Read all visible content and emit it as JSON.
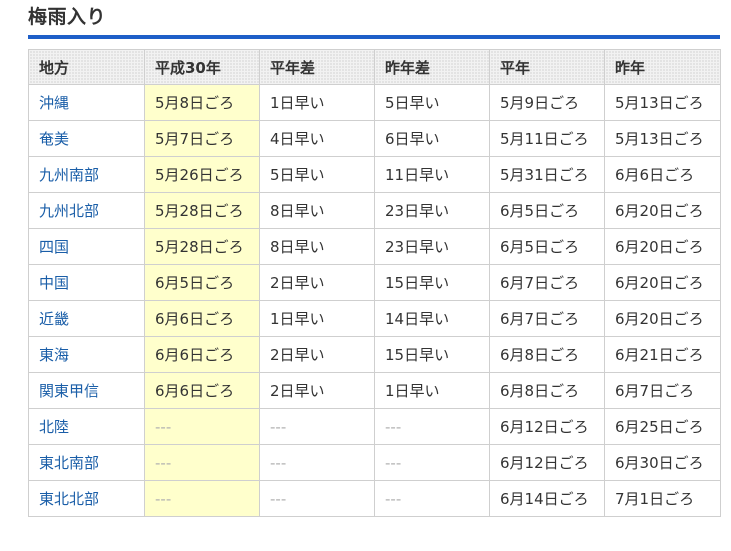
{
  "section_title": "梅雨入り",
  "headers": [
    "地方",
    "平成30年",
    "平年差",
    "昨年差",
    "平年",
    "昨年"
  ],
  "rows": [
    {
      "region": "沖縄",
      "h30": "5月8日ごろ",
      "diff_normal": "1日早い",
      "diff_last": "5日早い",
      "normal": "5月9日ごろ",
      "last": "5月13日ごろ"
    },
    {
      "region": "奄美",
      "h30": "5月7日ごろ",
      "diff_normal": "4日早い",
      "diff_last": "6日早い",
      "normal": "5月11日ごろ",
      "last": "5月13日ごろ"
    },
    {
      "region": "九州南部",
      "h30": "5月26日ごろ",
      "diff_normal": "5日早い",
      "diff_last": "11日早い",
      "normal": "5月31日ごろ",
      "last": "6月6日ごろ"
    },
    {
      "region": "九州北部",
      "h30": "5月28日ごろ",
      "diff_normal": "8日早い",
      "diff_last": "23日早い",
      "normal": "6月5日ごろ",
      "last": "6月20日ごろ"
    },
    {
      "region": "四国",
      "h30": "5月28日ごろ",
      "diff_normal": "8日早い",
      "diff_last": "23日早い",
      "normal": "6月5日ごろ",
      "last": "6月20日ごろ"
    },
    {
      "region": "中国",
      "h30": "6月5日ごろ",
      "diff_normal": "2日早い",
      "diff_last": "15日早い",
      "normal": "6月7日ごろ",
      "last": "6月20日ごろ"
    },
    {
      "region": "近畿",
      "h30": "6月6日ごろ",
      "diff_normal": "1日早い",
      "diff_last": "14日早い",
      "normal": "6月7日ごろ",
      "last": "6月20日ごろ"
    },
    {
      "region": "東海",
      "h30": "6月6日ごろ",
      "diff_normal": "2日早い",
      "diff_last": "15日早い",
      "normal": "6月8日ごろ",
      "last": "6月21日ごろ"
    },
    {
      "region": "関東甲信",
      "h30": "6月6日ごろ",
      "diff_normal": "2日早い",
      "diff_last": "1日早い",
      "normal": "6月8日ごろ",
      "last": "6月7日ごろ"
    },
    {
      "region": "北陸",
      "h30": "---",
      "diff_normal": "---",
      "diff_last": "---",
      "normal": "6月12日ごろ",
      "last": "6月25日ごろ"
    },
    {
      "region": "東北南部",
      "h30": "---",
      "diff_normal": "---",
      "diff_last": "---",
      "normal": "6月12日ごろ",
      "last": "6月30日ごろ"
    },
    {
      "region": "東北北部",
      "h30": "---",
      "diff_normal": "---",
      "diff_last": "---",
      "normal": "6月14日ごろ",
      "last": "7月1日ごろ"
    }
  ],
  "colors": {
    "title_rule": "#1e5fc8",
    "region_link": "#1a5ea8",
    "highlight_column": "#ffffcc",
    "dash_text": "#b0b0b0"
  }
}
